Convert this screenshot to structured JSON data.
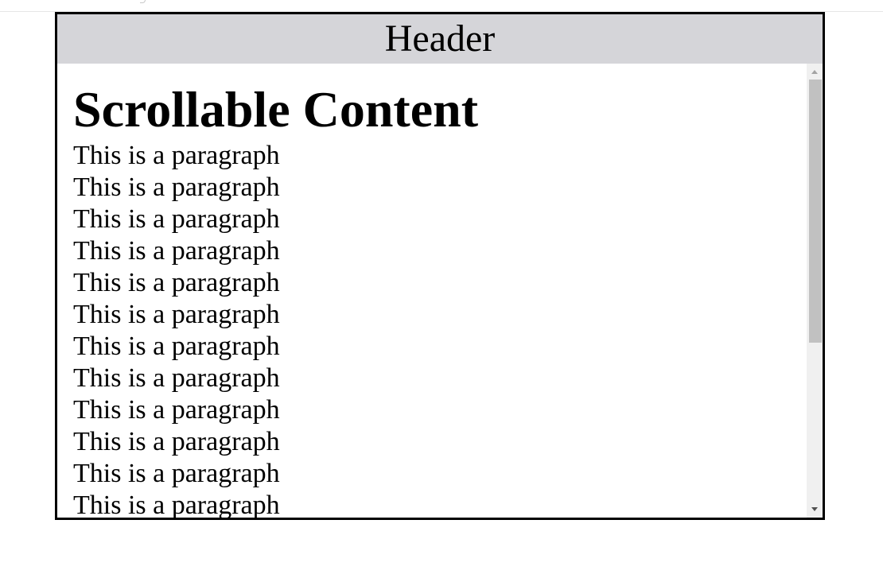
{
  "header": {
    "title": "Header"
  },
  "content": {
    "heading": "Scrollable Content",
    "paragraphs": [
      "This is a paragraph",
      "This is a paragraph",
      "This is a paragraph",
      "This is a paragraph",
      "This is a paragraph",
      "This is a paragraph",
      "This is a paragraph",
      "This is a paragraph",
      "This is a paragraph",
      "This is a paragraph",
      "This is a paragraph",
      "This is a paragraph"
    ]
  },
  "colors": {
    "header_background": "#d5d5d9",
    "panel_border": "#000000",
    "scrollbar_track": "#f0f0f0",
    "scrollbar_thumb": "#c1c1c1"
  }
}
